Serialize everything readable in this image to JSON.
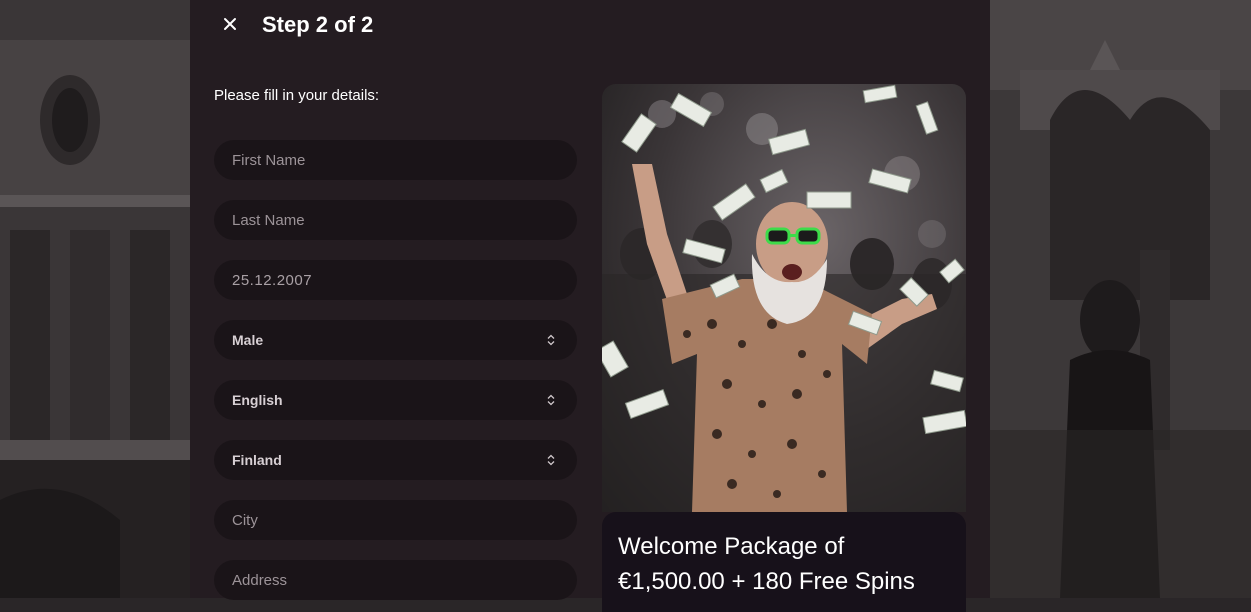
{
  "header": {
    "step_title": "Step 2 of 2",
    "close_icon": "close-icon"
  },
  "form": {
    "intro": "Please fill in your details:",
    "first_name": {
      "placeholder": "First Name",
      "value": ""
    },
    "last_name": {
      "placeholder": "Last Name",
      "value": ""
    },
    "birth_date": {
      "value": "25.12.2007"
    },
    "gender": {
      "selected": "Male"
    },
    "language": {
      "selected": "English"
    },
    "country": {
      "selected": "Finland"
    },
    "city": {
      "placeholder": "City",
      "value": ""
    },
    "address": {
      "placeholder": "Address",
      "value": ""
    }
  },
  "promo": {
    "title_line1": "Welcome Package of",
    "title_line2": "€1,500.00 + 180 Free Spins"
  },
  "colors": {
    "modal_bg": "#241c21",
    "field_bg": "#1a1418",
    "text_primary": "#ffffff",
    "glasses_green": "#3ddc4a"
  }
}
